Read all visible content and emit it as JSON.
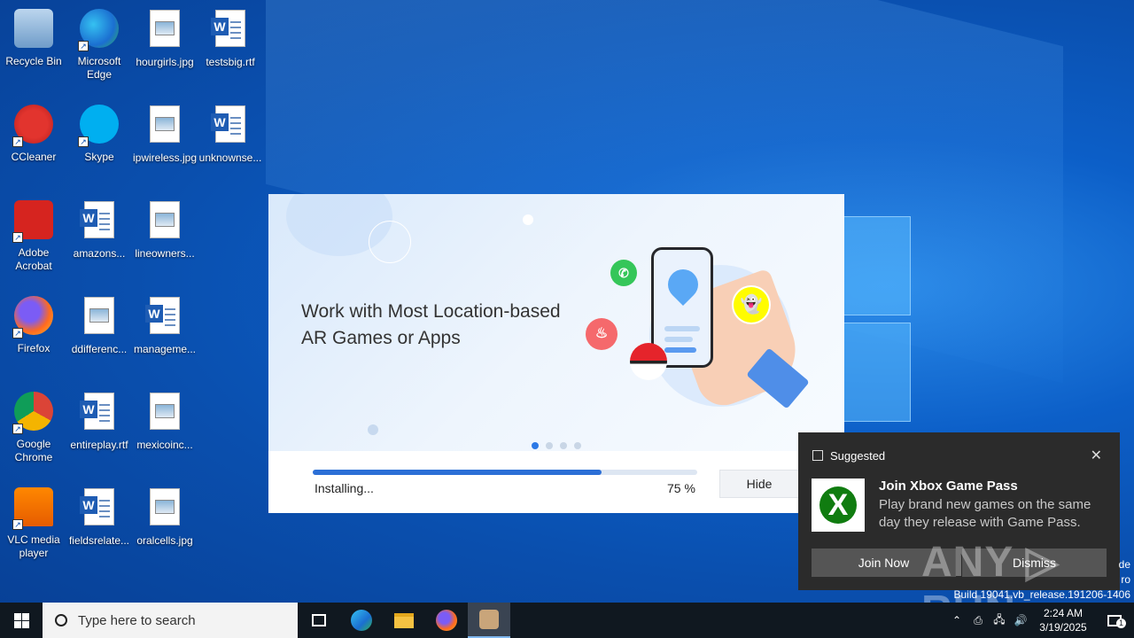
{
  "desktop": {
    "icons": [
      {
        "label": "Recycle Bin",
        "icon": "recycle-bin-icon"
      },
      {
        "label": "Microsoft Edge",
        "icon": "edge-icon"
      },
      {
        "label": "hourgirls.jpg",
        "icon": "image-file-icon"
      },
      {
        "label": "testsbig.rtf",
        "icon": "word-doc-icon"
      },
      {
        "label": "CCleaner",
        "icon": "ccleaner-icon"
      },
      {
        "label": "Skype",
        "icon": "skype-icon"
      },
      {
        "label": "ipwireless.jpg",
        "icon": "image-file-icon"
      },
      {
        "label": "unknownse...",
        "icon": "word-doc-icon"
      },
      {
        "label": "Adobe Acrobat",
        "icon": "acrobat-icon"
      },
      {
        "label": "amazons...",
        "icon": "word-doc-icon"
      },
      {
        "label": "lineowners...",
        "icon": "image-file-icon"
      },
      {
        "label": "Firefox",
        "icon": "firefox-icon"
      },
      {
        "label": "ddifferenc...",
        "icon": "image-file-icon"
      },
      {
        "label": "manageme...",
        "icon": "word-doc-icon"
      },
      {
        "label": "Google Chrome",
        "icon": "chrome-icon"
      },
      {
        "label": "entireplay.rtf",
        "icon": "word-doc-icon"
      },
      {
        "label": "mexicoinc...",
        "icon": "image-file-icon"
      },
      {
        "label": "VLC media player",
        "icon": "vlc-icon"
      },
      {
        "label": "fieldsrelate...",
        "icon": "word-doc-icon"
      },
      {
        "label": "oralcells.jpg",
        "icon": "image-file-icon"
      }
    ]
  },
  "installer": {
    "headline": "Work with Most Location-based AR Games or Apps",
    "status": "Installing...",
    "progress": 75,
    "progress_label": "75 %",
    "hide_label": "Hide",
    "slide_count": 4,
    "active_slide": 0,
    "accent_color": "#2c6fd6"
  },
  "toast": {
    "header": "Suggested",
    "title": "Join Xbox Game Pass",
    "body": "Play brand new games on the same day they release with Game Pass.",
    "primary_button": "Join Now",
    "secondary_button": "Dismiss",
    "close_glyph": "✕",
    "logo_glyph": "X"
  },
  "overlay": {
    "watermark": "ANY ▷ RUN",
    "build": "Build 19041.vb_release.191206-1406",
    "edge_text_1": "de",
    "edge_text_2": "ro"
  },
  "taskbar": {
    "search_placeholder": "Type here to search",
    "time": "2:24 AM",
    "date": "3/19/2025",
    "notification_count": "1"
  }
}
